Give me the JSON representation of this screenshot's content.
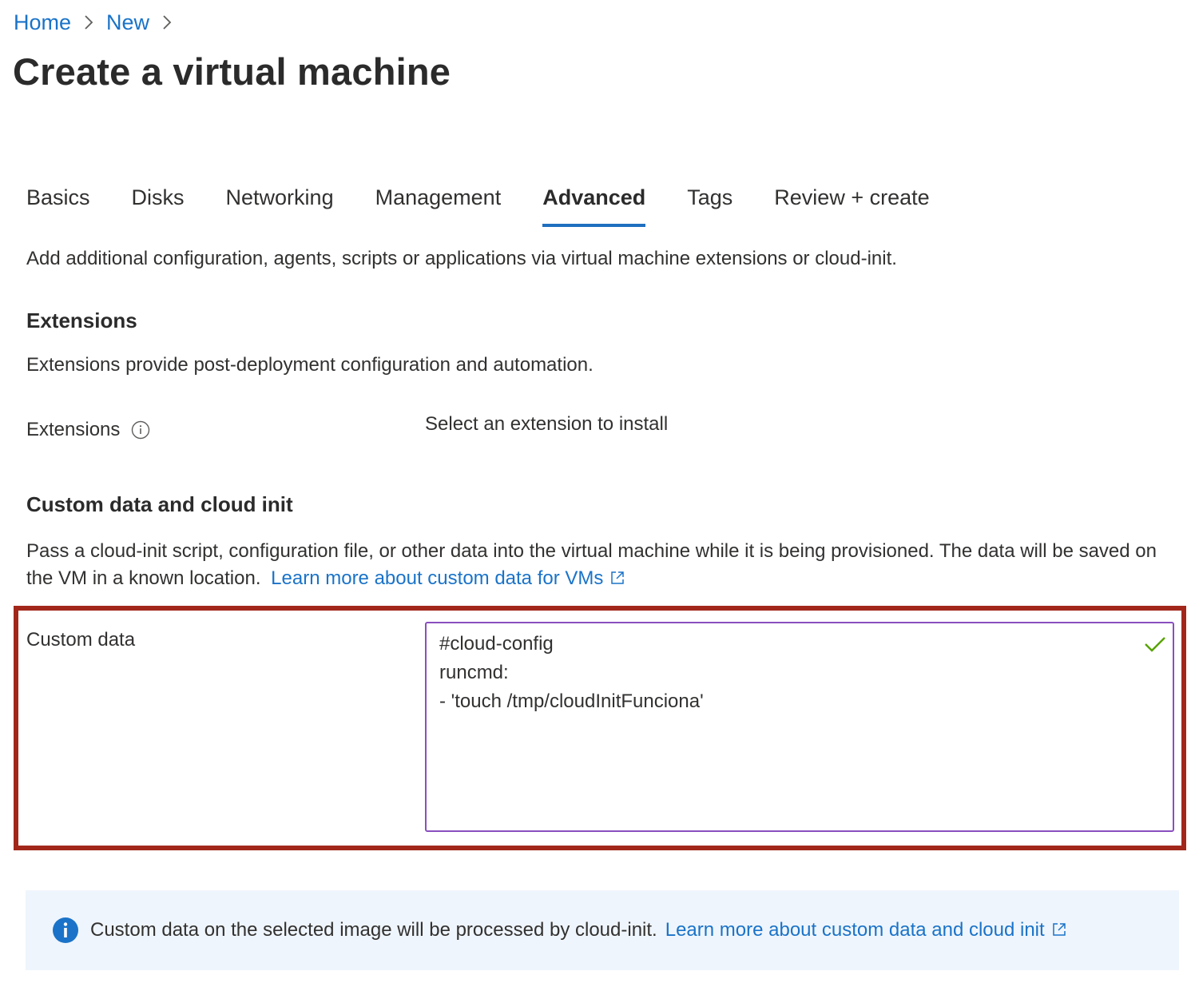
{
  "breadcrumb": {
    "items": [
      "Home",
      "New"
    ]
  },
  "page": {
    "title": "Create a virtual machine"
  },
  "tabs": [
    {
      "label": "Basics",
      "active": false
    },
    {
      "label": "Disks",
      "active": false
    },
    {
      "label": "Networking",
      "active": false
    },
    {
      "label": "Management",
      "active": false
    },
    {
      "label": "Advanced",
      "active": true
    },
    {
      "label": "Tags",
      "active": false
    },
    {
      "label": "Review + create",
      "active": false
    }
  ],
  "intro": "Add additional configuration, agents, scripts or applications via virtual machine extensions or cloud-init.",
  "extensions": {
    "heading": "Extensions",
    "description": "Extensions provide post-deployment configuration and automation.",
    "field_label": "Extensions",
    "link_text": "Select an extension to install"
  },
  "custom_data_section": {
    "heading": "Custom data and cloud init",
    "description": "Pass a cloud-init script, configuration file, or other data into the virtual machine while it is being provisioned. The data will be saved on the VM in a known location.",
    "learn_more_link": "Learn more about custom data for VMs",
    "field_label": "Custom data",
    "value_lines": [
      "#cloud-config",
      "runcmd:",
      "- 'touch /tmp/cloudInitFunciona'"
    ]
  },
  "info_bar": {
    "message": "Custom data on the selected image will be processed by cloud-init.",
    "link_text": "Learn more about custom data and cloud init"
  },
  "colors": {
    "link": "#1a73c8",
    "active_tab_underline": "#1f6fc0",
    "highlight_border": "#a2271b",
    "textarea_border": "#8a4fbf",
    "valid_check": "#57a300",
    "info_bar_bg": "#eff5fc",
    "info_icon": "#1a73c8"
  }
}
